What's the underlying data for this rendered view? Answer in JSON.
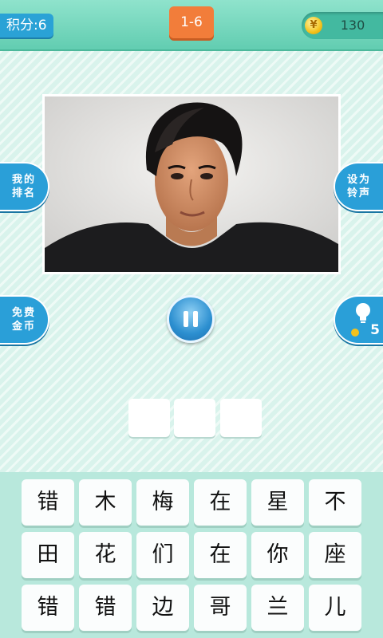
{
  "header": {
    "score_label": "积分:6",
    "level": "1-6",
    "coin_symbol": "¥",
    "coins": "130"
  },
  "side_buttons": {
    "my_rank": "我的排名",
    "set_ringtone": "设为铃声",
    "free_coins": "免费金币",
    "hint_count": "5"
  },
  "answer": {
    "slots": [
      "",
      "",
      ""
    ]
  },
  "keyboard": {
    "rows": [
      [
        "错",
        "木",
        "梅",
        "在",
        "星",
        "不"
      ],
      [
        "田",
        "花",
        "们",
        "在",
        "你",
        "座"
      ],
      [
        "错",
        "错",
        "边",
        "哥",
        "兰",
        "儿"
      ]
    ]
  },
  "colors": {
    "background": "#d9f3ec",
    "header": "#62cdb1",
    "accent_blue": "#2a9fd8",
    "level_orange": "#f27d3a",
    "coin_gold": "#f4c21c"
  },
  "icons": {
    "coin": "coin-icon",
    "pause": "pause-icon",
    "hint": "lightbulb-icon"
  }
}
